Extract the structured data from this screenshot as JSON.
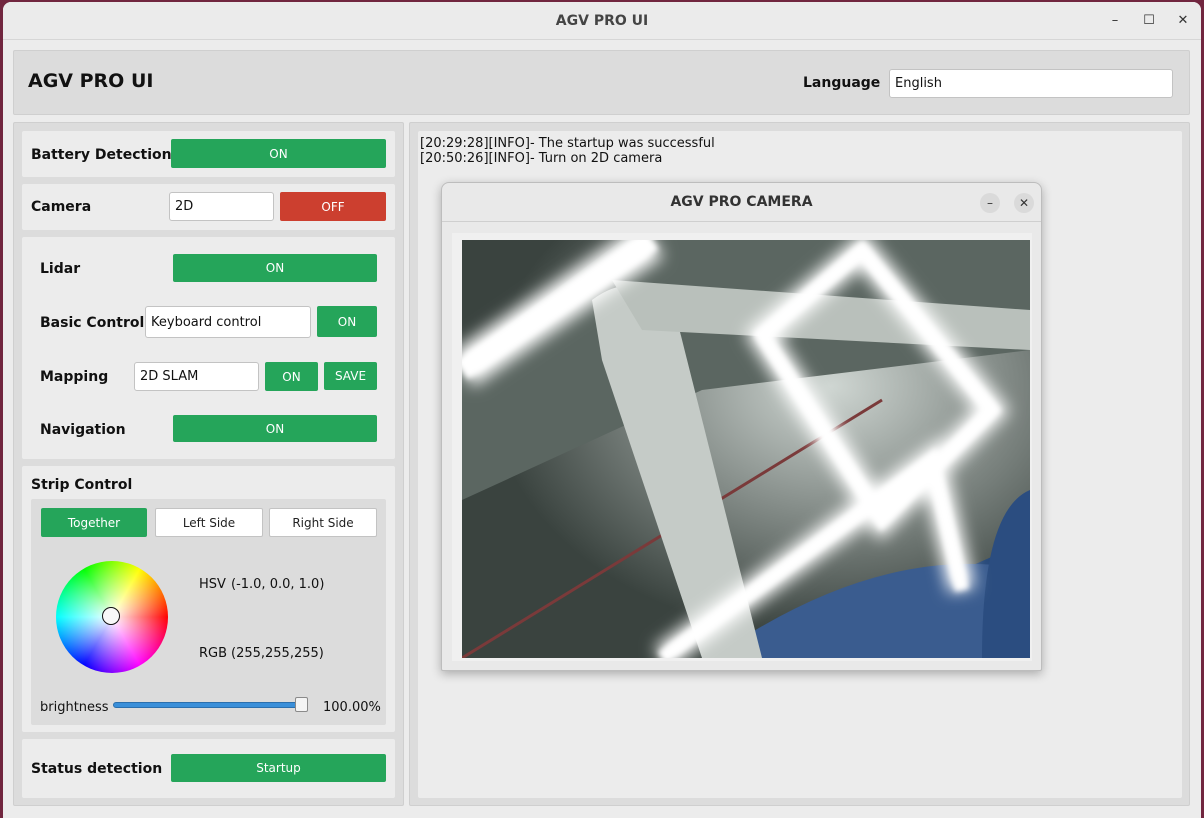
{
  "window": {
    "title": "AGV PRO UI",
    "controls": {
      "minimize": "–",
      "maximize": "☐",
      "close": "✕"
    }
  },
  "header": {
    "title": "AGV PRO UI",
    "language_label": "Language",
    "language_value": "English"
  },
  "battery": {
    "label": "Battery Detection",
    "button": "ON"
  },
  "camera": {
    "label": "Camera",
    "mode": "2D",
    "button": "OFF"
  },
  "lidar": {
    "label": "Lidar",
    "button": "ON"
  },
  "basic_control": {
    "label": "Basic Control",
    "mode": "Keyboard control",
    "button": "ON"
  },
  "mapping": {
    "label": "Mapping",
    "mode": "2D SLAM",
    "button": "ON",
    "save": "SAVE"
  },
  "navigation": {
    "label": "Navigation",
    "button": "ON"
  },
  "strip_control": {
    "label": "Strip Control",
    "tabs": [
      "Together",
      "Left Side",
      "Right Side"
    ],
    "active_tab": "Together",
    "hsv_label": "HSV",
    "hsv_value": "(-1.0, 0.0, 1.0)",
    "rgb_label": "RGB",
    "rgb_value": "(255,255,255)",
    "brightness_label": "brightness",
    "brightness_value": "100.00%",
    "brightness_level": 1.0
  },
  "status": {
    "label": "Status detection",
    "button": "Startup"
  },
  "log": {
    "lines": [
      "[20:29:28][INFO]- The startup was successful",
      "[20:50:26][INFO]- Turn on 2D camera"
    ]
  },
  "camera_window": {
    "title": "AGV PRO CAMERA",
    "minimize": "–",
    "close": "✕"
  },
  "colors": {
    "green": "#25a55a",
    "red": "#cc3f2f",
    "panel": "#dcdcdc",
    "background": "#ececec"
  }
}
